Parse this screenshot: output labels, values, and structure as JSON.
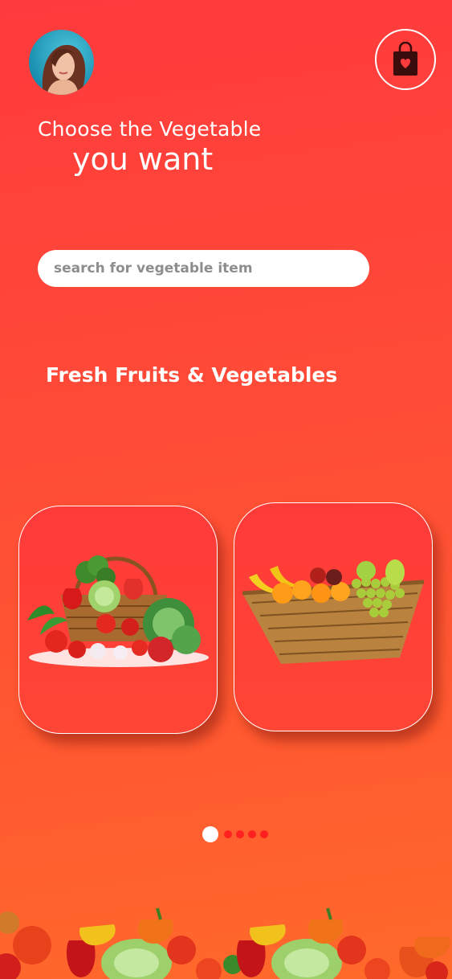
{
  "header": {
    "avatar_icon": "user-avatar-icon",
    "bag_icon": "shopping-bag-heart-icon"
  },
  "hero": {
    "line1": "Choose the Vegetable",
    "line2": "you want"
  },
  "search": {
    "placeholder": "search for vegetable item",
    "value": ""
  },
  "section": {
    "title": "Fresh Fruits & Vegetables"
  },
  "cards": [
    {
      "icon": "vegetable-basket-icon"
    },
    {
      "icon": "fruit-basket-icon"
    }
  ],
  "pagination": {
    "total": 5,
    "active_index": 0
  },
  "colors": {
    "background_top": "#ff3a3d",
    "background_bottom": "#ff6a2a",
    "dot_inactive": "#ff2020",
    "dot_active": "#ffffff"
  }
}
